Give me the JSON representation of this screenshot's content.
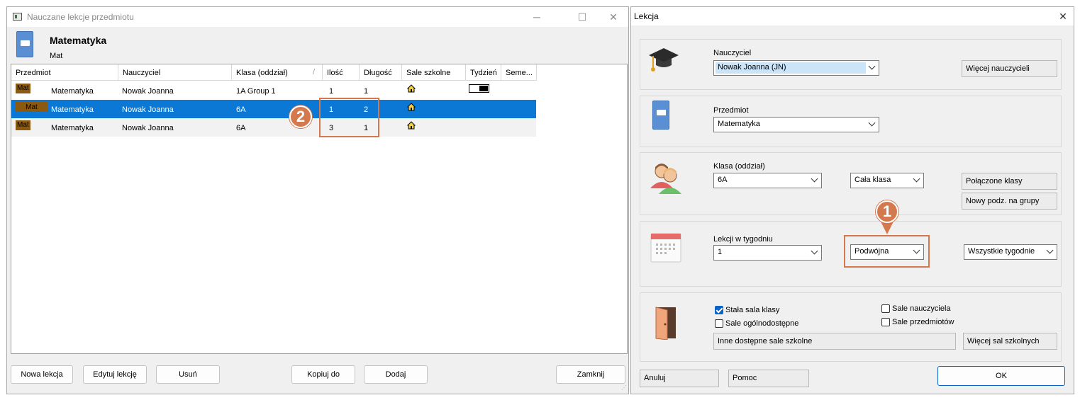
{
  "left_window": {
    "title": "Nauczane lekcje przedmiotu",
    "subject": {
      "name": "Matematyka",
      "short": "Mat"
    },
    "columns": [
      "Przedmiot",
      "Nauczyciel",
      "Klasa (oddział)",
      "Ilość",
      "Długość",
      "Sale szkolne",
      "Tydzień",
      "Seme..."
    ],
    "rows": [
      {
        "badge": "Mat",
        "subject": "Matematyka",
        "teacher": "Nowak Joanna",
        "class": "1A Group 1",
        "count": "1",
        "length": "1"
      },
      {
        "badge": "Mat",
        "subject": "Matematyka",
        "teacher": "Nowak Joanna",
        "class": "6A",
        "count": "1",
        "length": "2",
        "selected": true
      },
      {
        "badge": "Mat",
        "subject": "Matematyka",
        "teacher": "Nowak Joanna",
        "class": "6A",
        "count": "3",
        "length": "1"
      }
    ],
    "buttons": {
      "new_lesson": "Nowa lekcja",
      "edit_lesson": "Edytuj lekcję",
      "delete": "Usuń",
      "copy_to": "Kopiuj do",
      "add": "Dodaj",
      "close": "Zamknij"
    }
  },
  "right_window": {
    "title": "Lekcja",
    "teacher": {
      "label": "Nauczyciel",
      "value": "Nowak Joanna (JN)",
      "more_button": "Więcej nauczycieli"
    },
    "subject": {
      "label": "Przedmiot",
      "value": "Matematyka"
    },
    "class": {
      "label": "Klasa (oddział)",
      "value": "6A",
      "group": "Cała klasa",
      "linked_button": "Połączone klasy",
      "new_split_button": "Nowy podz. na grupy"
    },
    "per_week": {
      "label": "Lekcji w tygodniu",
      "value": "1",
      "length": "Podwójna",
      "weeks": "Wszystkie tygodnie"
    },
    "rooms": {
      "fixed_class_room": "Stała sala klasy",
      "public_rooms": "Sale ogólnodostępne",
      "teacher_rooms": "Sale nauczyciela",
      "subject_rooms": "Sale przedmiotów",
      "other_available": "Inne dostępne sale szkolne",
      "more_button": "Więcej sal szkolnych"
    },
    "buttons": {
      "cancel": "Anuluj",
      "help": "Pomoc",
      "ok": "OK"
    }
  },
  "callouts": {
    "one": "1",
    "two": "2"
  },
  "colors": {
    "selection": "#0a78d4",
    "callout": "#d4784e",
    "badge": "#8b5a10"
  }
}
